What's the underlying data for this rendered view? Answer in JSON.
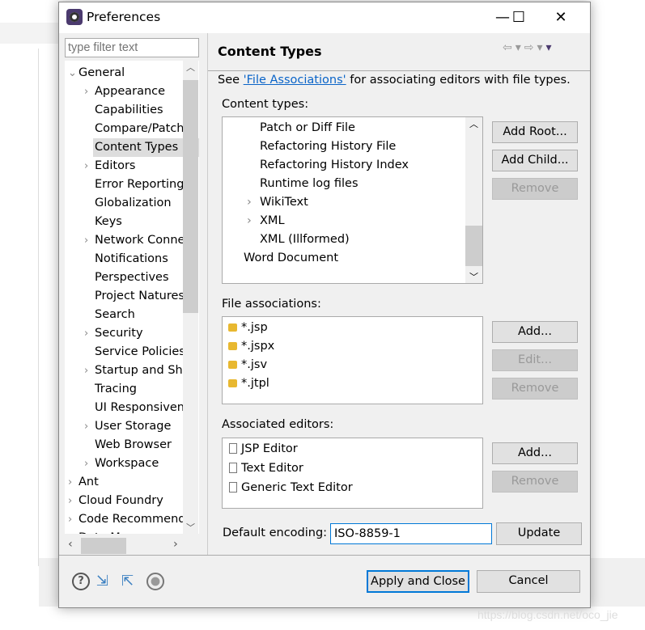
{
  "dialog": {
    "title": "Preferences",
    "minimize": "—",
    "maximize": "☐",
    "close": "✕"
  },
  "filter": {
    "placeholder": "type filter text"
  },
  "tree": [
    {
      "label": "General",
      "level": 0,
      "exp": "open"
    },
    {
      "label": "Appearance",
      "level": 1,
      "exp": "closed"
    },
    {
      "label": "Capabilities",
      "level": 1,
      "exp": ""
    },
    {
      "label": "Compare/Patch",
      "level": 1,
      "exp": ""
    },
    {
      "label": "Content Types",
      "level": 1,
      "exp": "",
      "selected": true
    },
    {
      "label": "Editors",
      "level": 1,
      "exp": "closed"
    },
    {
      "label": "Error Reporting",
      "level": 1,
      "exp": ""
    },
    {
      "label": "Globalization",
      "level": 1,
      "exp": ""
    },
    {
      "label": "Keys",
      "level": 1,
      "exp": ""
    },
    {
      "label": "Network Connections",
      "level": 1,
      "exp": "closed"
    },
    {
      "label": "Notifications",
      "level": 1,
      "exp": ""
    },
    {
      "label": "Perspectives",
      "level": 1,
      "exp": ""
    },
    {
      "label": "Project Natures",
      "level": 1,
      "exp": ""
    },
    {
      "label": "Search",
      "level": 1,
      "exp": ""
    },
    {
      "label": "Security",
      "level": 1,
      "exp": "closed"
    },
    {
      "label": "Service Policies",
      "level": 1,
      "exp": ""
    },
    {
      "label": "Startup and Shutdown",
      "level": 1,
      "exp": "closed"
    },
    {
      "label": "Tracing",
      "level": 1,
      "exp": ""
    },
    {
      "label": "UI Responsiveness",
      "level": 1,
      "exp": ""
    },
    {
      "label": "User Storage",
      "level": 1,
      "exp": "closed"
    },
    {
      "label": "Web Browser",
      "level": 1,
      "exp": ""
    },
    {
      "label": "Workspace",
      "level": 1,
      "exp": "closed"
    },
    {
      "label": "Ant",
      "level": 0,
      "exp": "closed"
    },
    {
      "label": "Cloud Foundry",
      "level": 0,
      "exp": "closed"
    },
    {
      "label": "Code Recommenders",
      "level": 0,
      "exp": "closed"
    },
    {
      "label": "Data Management",
      "level": 0,
      "exp": "closed"
    }
  ],
  "page": {
    "heading": "Content Types",
    "desc_prefix": "See ",
    "desc_link": "'File Associations'",
    "desc_suffix": " for associating editors with file types.",
    "content_types_label": "Content types:",
    "content_types": [
      {
        "label": "Patch or Diff File",
        "indent": 2,
        "exp": ""
      },
      {
        "label": "Refactoring History File",
        "indent": 2,
        "exp": ""
      },
      {
        "label": "Refactoring History Index",
        "indent": 2,
        "exp": ""
      },
      {
        "label": "Runtime log files",
        "indent": 2,
        "exp": ""
      },
      {
        "label": "WikiText",
        "indent": 2,
        "exp": "closed"
      },
      {
        "label": "XML",
        "indent": 2,
        "exp": "closed"
      },
      {
        "label": "XML (Illformed)",
        "indent": 2,
        "exp": ""
      },
      {
        "label": "Word Document",
        "indent": 1,
        "exp": ""
      }
    ],
    "add_root": "Add Root...",
    "add_child": "Add Child...",
    "remove": "Remove",
    "file_assoc_label": "File associations:",
    "file_assoc": [
      "*.jsp",
      "*.jspx",
      "*.jsv",
      "*.jtpl"
    ],
    "add": "Add...",
    "edit": "Edit...",
    "editors_label": "Associated editors:",
    "editors": [
      "JSP Editor",
      "Text Editor",
      "Generic Text Editor"
    ],
    "encoding_label": "Default encoding:",
    "encoding_value": "ISO-8859-1",
    "update": "Update"
  },
  "footer": {
    "apply_close": "Apply and Close",
    "cancel": "Cancel"
  },
  "watermark": "https://blog.csdn.net/oco_jie",
  "colors": {
    "link": "#0a64c8",
    "focus": "#0078d7"
  }
}
